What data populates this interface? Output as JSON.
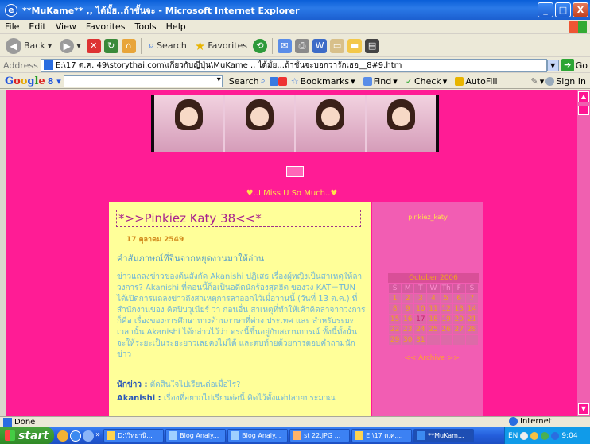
{
  "window": {
    "title": "**MuKame** ,, ได้มั้ย..ถ้าชั้นจะ - Microsoft Internet Explorer",
    "buttons": {
      "minimize": "_",
      "maximize": "□",
      "close": "X"
    }
  },
  "menu": [
    "File",
    "Edit",
    "View",
    "Favorites",
    "Tools",
    "Help"
  ],
  "toolbar": {
    "back": "Back",
    "search": "Search",
    "favorites": "Favorites"
  },
  "address": {
    "label": "Address",
    "url": "E:\\17 ต.ค. 49\\storythai.com\\เกี่ยวกับญี่ปุ่น\\MuKame ,, ได้มั้ย...ถ้าชั้นจะบอกว่ารักเธอ__8#9.htm",
    "go": "Go"
  },
  "google": {
    "logo": [
      "G",
      "o",
      "o",
      "g",
      "l",
      "e"
    ],
    "g_dropdown": "8",
    "search": "Search",
    "bookmarks": "Bookmarks",
    "find": "Find",
    "check": "Check",
    "autofill": "AutoFill",
    "signin": "Sign In"
  },
  "page": {
    "miss_you": "♥..I Miss U So Much..♥",
    "post": {
      "title": "*>>Pinkiez Katy 38<<*",
      "date": "17 ตุลาคม 2549",
      "heading": "คำสัมภาษณ์ที่จินจากหยุดงานมาให้อ่าน",
      "paragraph": "ข่าวแถลงข่าวของต้นสังกัด Akanishi ปฏิเสธ เรื่องผู้หญิงเป็นสาเหตุให้ลาวงการ? Akanishi ที่ตอนนี้ก็อเป็นอดีตนักร้องสุดฮิต ของวง KAT－TUN ได้เปิดการแถลงข่าวถึงสาเหตุการลาออกไว้เมื่อวานนี้ (วันที่ 13 ต.ค.) ที่สำนักงานของ คิตปิบวุเนียร์ ว่า ก่อนอื่น สาเหตุที่ทำให้เค้าคิดลาจากวงการก็คือ เรื่องของการศึกษาทางด้านภาษาที่ต่าง ประเทศ และ สำหรับระยะเวลานั้น Akanishi ได้กล่าวไว้ว่า ตรงนี้ขึ้นอยู่กับสถานการณ์ ทั้งนี้ทั้งนั้น จะให้ระยะเป็นระยะยาวเลยคงไม่ได้ และตบท้ายด้วยการตอบคำถามนักข่าว",
      "q_label": "นักข่าว :",
      "q_text": "ตัดสินใจไปเรียนต่อเมื่อไร?",
      "a_label": "Akanishi :",
      "a_text": "เรื่องที่อยากไปเรียนต่อนี้ คิดไว้ตั้งแต่ปลายประมาณ"
    },
    "sidebar": {
      "author": "pinkiez_katy",
      "calendar": {
        "month": "October 2006",
        "days": [
          "S",
          "M",
          "T",
          "W",
          "Th",
          "F",
          "S"
        ],
        "weeks": [
          [
            "1",
            "2",
            "3",
            "4",
            "5",
            "6",
            "7"
          ],
          [
            "8",
            "9",
            "10",
            "11",
            "12",
            "13",
            "14"
          ],
          [
            "15",
            "16",
            "17",
            "18",
            "19",
            "20",
            "21"
          ],
          [
            "22",
            "23",
            "24",
            "25",
            "26",
            "27",
            "28"
          ],
          [
            "29",
            "30",
            "31",
            "",
            "",
            "",
            ""
          ]
        ],
        "highlight": "17"
      },
      "archive": "<< Archive >>"
    }
  },
  "status": {
    "left": "Done",
    "zone": "Internet"
  },
  "taskbar": {
    "start": "start",
    "tasks": [
      "D:\\วิทยานิ...",
      "Blog Analy...",
      "Blog Analy...",
      "st 22.JPG ...",
      "E:\\17 ต.ค....",
      "**MuKam..."
    ],
    "lang": "EN",
    "clock": "9:04"
  },
  "colors": {
    "page_bg": "#ff1c95",
    "post_bg": "#ffff99",
    "sidebar_bg": "#f25db3",
    "title_text": "#a8208e"
  }
}
